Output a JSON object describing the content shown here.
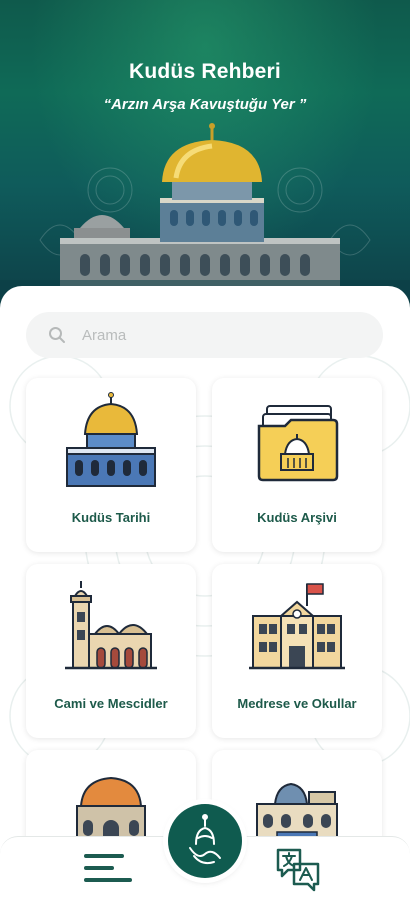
{
  "header": {
    "title": "Kudüs Rehberi",
    "subtitle": "“Arzın Arşa Kavuştuğu Yer ”"
  },
  "search": {
    "placeholder": "Arama"
  },
  "categories": [
    {
      "label": "Kudüs Tarihi",
      "icon": "dome-of-rock-icon"
    },
    {
      "label": "Kudüs Arşivi",
      "icon": "archive-folder-icon"
    },
    {
      "label": "Cami ve Mescidler",
      "icon": "mosque-icon"
    },
    {
      "label": "Medrese ve Okullar",
      "icon": "school-building-icon"
    },
    {
      "label": "",
      "icon": "domed-tomb-icon"
    },
    {
      "label": "",
      "icon": "historic-building-icon"
    }
  ],
  "bottom_nav": {
    "menu_icon": "hamburger-menu-icon",
    "center_icon": "calligraphy-logo-icon",
    "translate_icon": "translate-icon"
  },
  "colors": {
    "primary": "#0f5b4f",
    "label": "#1d5a4a",
    "gold": "#e3b92e"
  }
}
